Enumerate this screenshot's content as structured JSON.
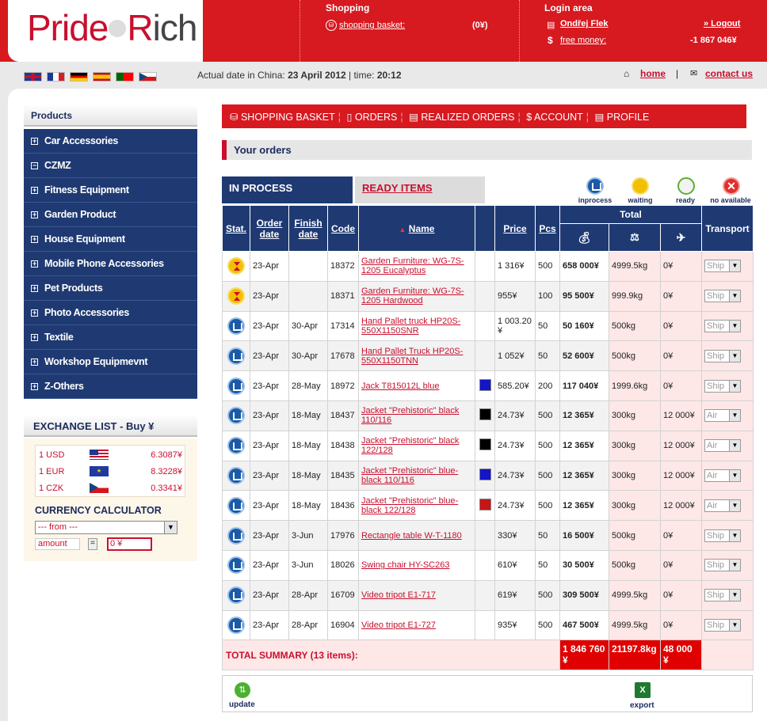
{
  "brand": {
    "logo_left": "Pride",
    "logo_right": "ich",
    "logo_r": "R"
  },
  "header": {
    "shopping_title": "Shopping",
    "basket_label": "shopping basket:",
    "basket_value": "(0¥)",
    "login_title": "Login area",
    "user_name": "Ondřej Flek",
    "logout": "» Logout",
    "money_label": "free money:",
    "money_value": "-1 867 046¥"
  },
  "dateline": {
    "prefix": "Actual date in China: ",
    "date": "23 April 2012",
    "mid": " | time: ",
    "time": "20:12"
  },
  "toplinks": {
    "home": "home",
    "sep": "|",
    "contact": "contact us"
  },
  "sidebar": {
    "title": "Products",
    "items": [
      {
        "label": "Car Accessories",
        "sign": "+"
      },
      {
        "label": "CZMZ",
        "sign": "−"
      },
      {
        "label": "Fitness Equipment",
        "sign": "+"
      },
      {
        "label": "Garden Product",
        "sign": "+"
      },
      {
        "label": "House Equipment",
        "sign": "+"
      },
      {
        "label": "Mobile Phone Accessories",
        "sign": "+"
      },
      {
        "label": "Pet Products",
        "sign": "+"
      },
      {
        "label": "Photo Accessories",
        "sign": "+"
      },
      {
        "label": "Textile",
        "sign": "+"
      },
      {
        "label": "Workshop Equipmevnt",
        "sign": "+"
      },
      {
        "label": "Z-Others",
        "sign": "+"
      }
    ]
  },
  "exchange": {
    "title": "EXCHANGE LIST - Buy ¥",
    "rows": [
      {
        "unit": "1 USD",
        "rate": "6.3087¥"
      },
      {
        "unit": "1 EUR",
        "rate": "8.3228¥"
      },
      {
        "unit": "1 CZK",
        "rate": "0.3341¥"
      }
    ],
    "calc_title": "CURRENCY CALCULATOR",
    "from_placeholder": "--- from ---",
    "amount_placeholder": "amount",
    "equals": "=",
    "result": "0 ¥"
  },
  "nav": {
    "items": [
      "SHOPPING BASKET",
      "ORDERS",
      "REALIZED ORDERS",
      "ACCOUNT",
      "PROFILE"
    ]
  },
  "orders": {
    "heading": "Your orders",
    "tab_active": "IN PROCESS",
    "tab_other": "READY ITEMS",
    "legend": [
      "inprocess",
      "waiting",
      "ready",
      "no available"
    ],
    "columns": {
      "stat": "Stat.",
      "order_date": "Order date",
      "finish_date": "Finish date",
      "code": "Code",
      "name": "Name",
      "price": "Price",
      "pcs": "Pcs",
      "total": "Total",
      "transport": "Transport"
    },
    "rows": [
      {
        "status": "waiting",
        "order": "23-Apr",
        "finish": "",
        "code": "18372",
        "name": "Garden Furniture: WG-7S-1205 Eucalyptus",
        "color": "",
        "price": "1 316¥",
        "pcs": "500",
        "total": "658 000¥",
        "weight": "4999.5kg",
        "fee": "0¥",
        "transport": "Ship"
      },
      {
        "status": "waiting",
        "order": "23-Apr",
        "finish": "",
        "code": "18371",
        "name": "Garden Furniture: WG-7S-1205 Hardwood",
        "color": "",
        "price": "955¥",
        "pcs": "100",
        "total": "95 500¥",
        "weight": "999.9kg",
        "fee": "0¥",
        "transport": "Ship"
      },
      {
        "status": "inprocess",
        "order": "23-Apr",
        "finish": "30-Apr",
        "code": "17314",
        "name": "Hand Pallet truck HP20S-550X1150SNR",
        "color": "",
        "price": "1 003.20 ¥",
        "pcs": "50",
        "total": "50 160¥",
        "weight": "500kg",
        "fee": "0¥",
        "transport": "Ship"
      },
      {
        "status": "inprocess",
        "order": "23-Apr",
        "finish": "30-Apr",
        "code": "17678",
        "name": "Hand Pallet Truck HP20S-550X1150TNN",
        "color": "",
        "price": "1 052¥",
        "pcs": "50",
        "total": "52 600¥",
        "weight": "500kg",
        "fee": "0¥",
        "transport": "Ship"
      },
      {
        "status": "inprocess",
        "order": "23-Apr",
        "finish": "28-May",
        "code": "18972",
        "name": "Jack T815012L blue",
        "color": "#1414c8",
        "price": "585.20¥",
        "pcs": "200",
        "total": "117 040¥",
        "weight": "1999.6kg",
        "fee": "0¥",
        "transport": "Ship"
      },
      {
        "status": "inprocess",
        "order": "23-Apr",
        "finish": "18-May",
        "code": "18437",
        "name": "Jacket \"Prehistoric\" black 110/116",
        "color": "#000000",
        "price": "24.73¥",
        "pcs": "500",
        "total": "12 365¥",
        "weight": "300kg",
        "fee": "12 000¥",
        "transport": "Air"
      },
      {
        "status": "inprocess",
        "order": "23-Apr",
        "finish": "18-May",
        "code": "18438",
        "name": "Jacket \"Prehistoric\" black 122/128",
        "color": "#000000",
        "price": "24.73¥",
        "pcs": "500",
        "total": "12 365¥",
        "weight": "300kg",
        "fee": "12 000¥",
        "transport": "Air"
      },
      {
        "status": "inprocess",
        "order": "23-Apr",
        "finish": "18-May",
        "code": "18435",
        "name": "Jacket \"Prehistoric\" blue-black 110/116",
        "color": "#1414c8",
        "price": "24.73¥",
        "pcs": "500",
        "total": "12 365¥",
        "weight": "300kg",
        "fee": "12 000¥",
        "transport": "Air"
      },
      {
        "status": "inprocess",
        "order": "23-Apr",
        "finish": "18-May",
        "code": "18436",
        "name": "Jacket \"Prehistoric\" blue-black 122/128",
        "color": "#c81414",
        "price": "24.73¥",
        "pcs": "500",
        "total": "12 365¥",
        "weight": "300kg",
        "fee": "12 000¥",
        "transport": "Air"
      },
      {
        "status": "inprocess",
        "order": "23-Apr",
        "finish": "3-Jun",
        "code": "17976",
        "name": "Rectangle table W-T-1180",
        "color": "",
        "price": "330¥",
        "pcs": "50",
        "total": "16 500¥",
        "weight": "500kg",
        "fee": "0¥",
        "transport": "Ship"
      },
      {
        "status": "inprocess",
        "order": "23-Apr",
        "finish": "3-Jun",
        "code": "18026",
        "name": "Swing chair HY-SC263",
        "color": "",
        "price": "610¥",
        "pcs": "50",
        "total": "30 500¥",
        "weight": "500kg",
        "fee": "0¥",
        "transport": "Ship"
      },
      {
        "status": "inprocess",
        "order": "23-Apr",
        "finish": "28-Apr",
        "code": "16709",
        "name": "Video tripot E1-717",
        "color": "",
        "price": "619¥",
        "pcs": "500",
        "total": "309 500¥",
        "weight": "4999.5kg",
        "fee": "0¥",
        "transport": "Ship"
      },
      {
        "status": "inprocess",
        "order": "23-Apr",
        "finish": "28-Apr",
        "code": "16904",
        "name": "Video tripot E1-727",
        "color": "",
        "price": "935¥",
        "pcs": "500",
        "total": "467 500¥",
        "weight": "4999.5kg",
        "fee": "0¥",
        "transport": "Ship"
      }
    ],
    "summary": {
      "label": "TOTAL SUMMARY (13 items):",
      "total": "1 846 760 ¥",
      "weight": "21197.8kg",
      "fee": "48 000 ¥"
    },
    "actions": {
      "update": "update",
      "export": "export"
    }
  },
  "colors": {
    "brand_red": "#d71920",
    "navy": "#1f3a72",
    "link_red": "#c8102e"
  }
}
